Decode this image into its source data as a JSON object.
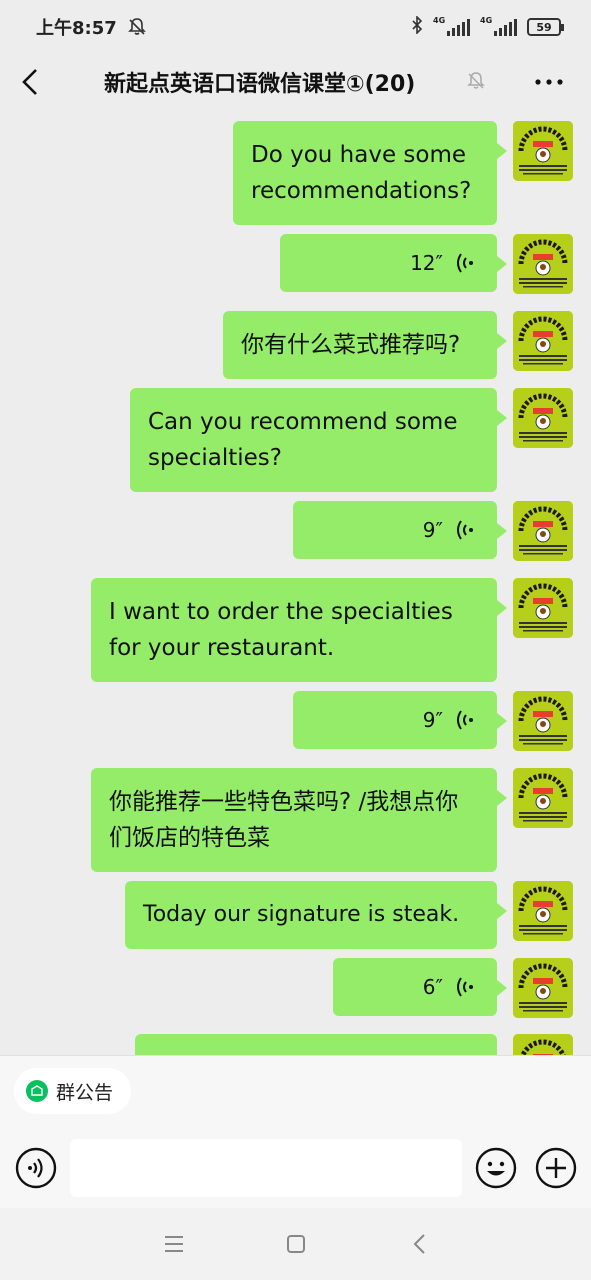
{
  "status": {
    "time": "上午8:57",
    "battery": "59",
    "net1": "4G",
    "net2": "4G"
  },
  "nav": {
    "title": "新起点英语口语微信课堂①(20)"
  },
  "messages": [
    {
      "type": "text",
      "lines": [
        "Do you have some",
        "recommendations?"
      ]
    },
    {
      "type": "voice",
      "duration": "12″"
    },
    {
      "type": "text",
      "lines": [
        "你有什么菜式推荐吗?"
      ]
    },
    {
      "type": "text",
      "lines": [
        "Can you recommend some",
        "specialties?"
      ]
    },
    {
      "type": "voice",
      "duration": "9″"
    },
    {
      "type": "text",
      "lines": [
        "I want to order the specialties",
        "for your restaurant."
      ]
    },
    {
      "type": "voice",
      "duration": "9″"
    },
    {
      "type": "text",
      "lines": [
        "你能推荐一些特色菜吗? /我想点你",
        "们饭店的特色菜"
      ]
    },
    {
      "type": "text",
      "lines": [
        "Today our signature is steak."
      ]
    },
    {
      "type": "voice",
      "duration": "6″"
    }
  ],
  "bottom": {
    "notice_label": "群公告",
    "input_placeholder": ""
  },
  "colors": {
    "bubble": "#95ec69",
    "background": "#ededed",
    "avatar": "#b6cf1a"
  }
}
